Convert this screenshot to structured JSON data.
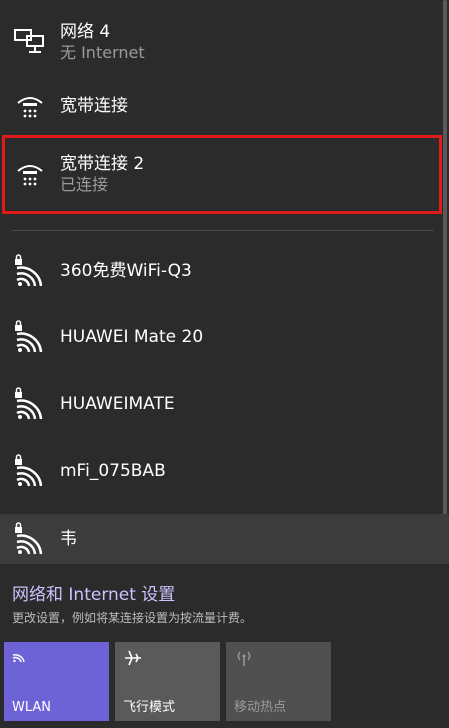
{
  "networks": [
    {
      "name": "网络 4",
      "status": "无 Internet",
      "icon": "wired-network-icon"
    },
    {
      "name": "宽带连接",
      "status": "",
      "icon": "dialup-icon"
    },
    {
      "name": "宽带连接 2",
      "status": "已连接",
      "icon": "dialup-icon"
    },
    {
      "name": "360免费WiFi-Q3",
      "icon": "secured-wifi-icon"
    },
    {
      "name": "HUAWEI Mate 20",
      "icon": "secured-wifi-icon"
    },
    {
      "name": "HUAWEIMATE",
      "icon": "secured-wifi-icon"
    },
    {
      "name": "mFi_075BAB",
      "icon": "secured-wifi-icon"
    },
    {
      "name": "韦",
      "icon": "secured-wifi-icon"
    }
  ],
  "settings": {
    "title": "网络和 Internet 设置",
    "description": "更改设置，例如将某连接设置为按流量计费。"
  },
  "quick_actions": [
    {
      "label": "WLAN",
      "icon": "wifi-icon",
      "state": "on"
    },
    {
      "label": "飞行模式",
      "icon": "airplane-icon",
      "state": "off"
    },
    {
      "label": "移动热点",
      "icon": "hotspot-icon",
      "state": "disabled"
    }
  ],
  "colors": {
    "background": "#2b2b2b",
    "accent": "#6e63d6",
    "highlight_border": "#e01b1b"
  }
}
